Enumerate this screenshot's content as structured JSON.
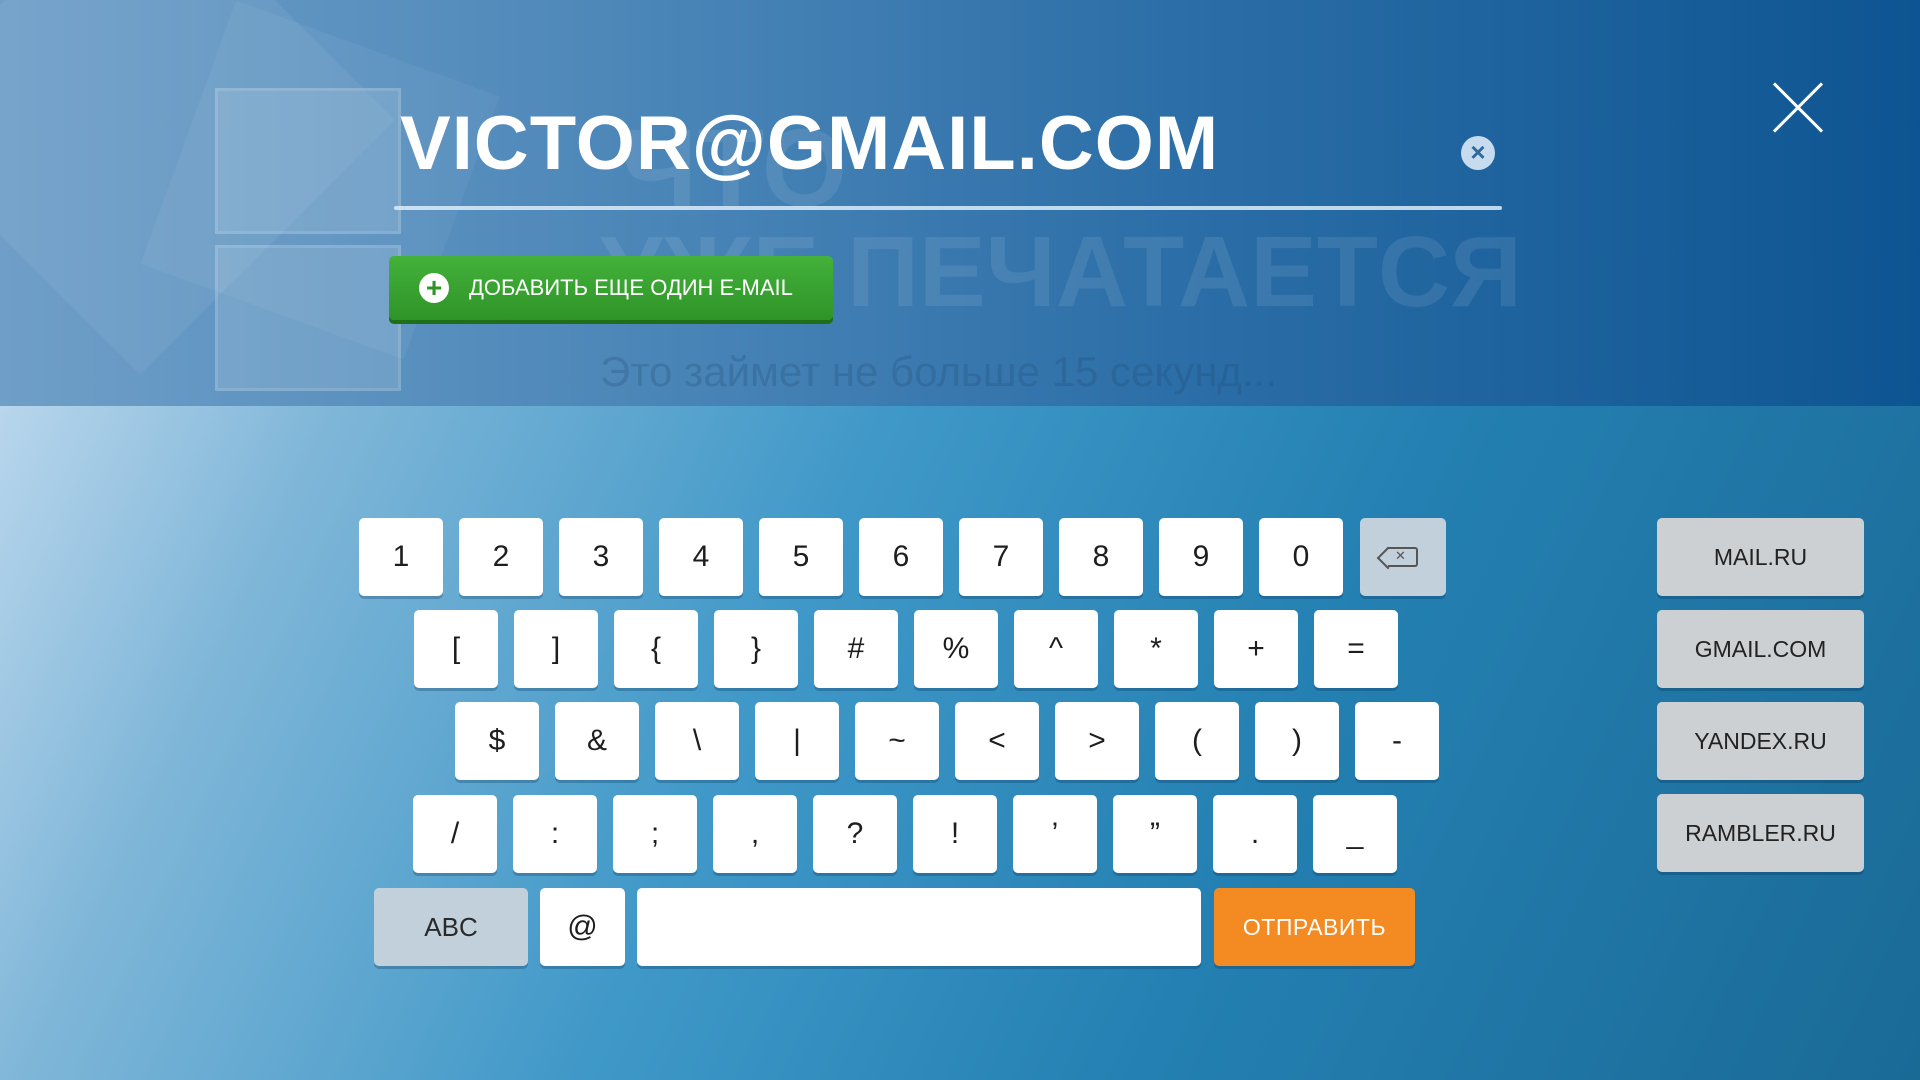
{
  "background_text": {
    "line1": "ЧТО",
    "line2": "УЖЕ ПЕЧАТАЕТСЯ",
    "line3": "Это займет не больше 15 секунд..."
  },
  "email": {
    "value": "VICTOR@GMAIL.COM",
    "clear_icon": "clear-icon",
    "close_icon": "close-icon"
  },
  "add_email_button": {
    "label": "ДОБАВИТЬ ЕЩЕ ОДИН E-MAIL",
    "icon": "plus-icon"
  },
  "keyboard": {
    "row1": [
      "1",
      "2",
      "3",
      "4",
      "5",
      "6",
      "7",
      "8",
      "9",
      "0"
    ],
    "backspace_icon": "backspace-icon",
    "row2": [
      "[",
      "]",
      "{",
      "}",
      "#",
      "%",
      "^",
      "*",
      "+",
      "="
    ],
    "row3": [
      "$",
      "&",
      "\\",
      "|",
      "~",
      "<",
      ">",
      "(",
      ")",
      "-"
    ],
    "row4": [
      "/",
      ":",
      ";",
      ",",
      "?",
      "!",
      "’",
      "”",
      ".",
      "_"
    ],
    "abc_label": "ABC",
    "at_label": "@",
    "send_label": "ОТПРАВИТЬ"
  },
  "domains": [
    "MAIL.RU",
    "GMAIL.COM",
    "YANDEX.RU",
    "RAMBLER.RU"
  ],
  "colors": {
    "accent_green": "#38a232",
    "send_orange": "#f38a22",
    "header_blue": "#2d6fa8"
  }
}
